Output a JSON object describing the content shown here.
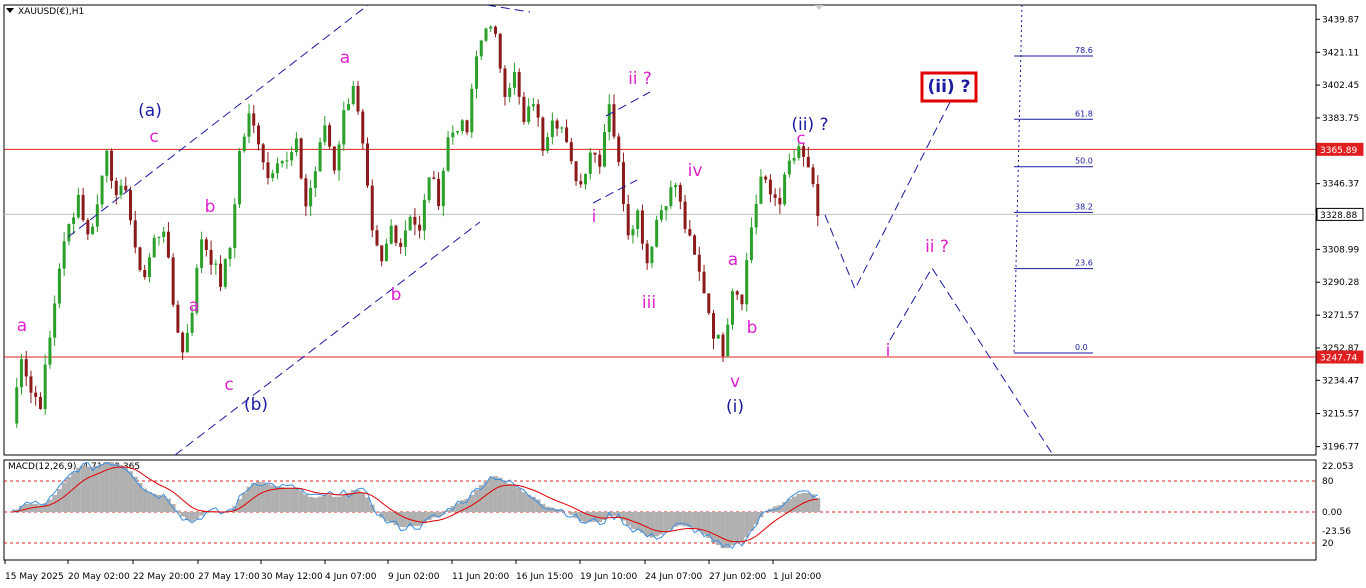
{
  "symbol_title": "XAUUSD(€),H1",
  "macd_title": "MACD(12,26,9) -4.711 -2.365",
  "colors": {
    "bull": "#2aa02a",
    "bear": "#8b1a1a",
    "wave_blue": "#1a1aa0",
    "wave_magenta": "#e020d0",
    "hline": "#e02020",
    "fib": "#1a1aa0",
    "signal": "#e00000",
    "macd_line": "#3a8ee0",
    "hist": "#b0b0b0"
  },
  "price_axis": {
    "labels": [
      "3439.87",
      "3421.11",
      "3402.45",
      "3383.75",
      "3365.04",
      "3346.37",
      "3327.69",
      "3308.99",
      "3290.28",
      "3271.57",
      "3252.87",
      "3234.47",
      "3215.57",
      "3196.77"
    ]
  },
  "price_tags": [
    {
      "label": "3365.89",
      "style": "red"
    },
    {
      "label": "3328.88",
      "style": "current"
    },
    {
      "label": "3247.74",
      "style": "red"
    }
  ],
  "time_axis": {
    "labels": [
      "15 May 2025",
      "20 May 02:00",
      "22 May 20:00",
      "27 May 17:00",
      "30 May 12:00",
      "4 Jun 07:00",
      "9 Jun 02:00",
      "11 Jun 20:00",
      "16 Jun 15:00",
      "19 Jun 10:00",
      "24 Jun 07:00",
      "27 Jun 02:00",
      "1 Jul 20:00"
    ]
  },
  "fib_levels": [
    {
      "label": "78.6",
      "price": 3419
    },
    {
      "label": "61.8",
      "price": 3383
    },
    {
      "label": "50.0",
      "price": 3356
    },
    {
      "label": "38.2",
      "price": 3330
    },
    {
      "label": "23.6",
      "price": 3298
    },
    {
      "label": "0.0",
      "price": 3250
    }
  ],
  "horizontal_lines": [
    3365.89,
    3247.74
  ],
  "current_price": 3328.88,
  "wave_labels": [
    {
      "text": "a",
      "color": "magenta"
    },
    {
      "text": "(a)",
      "color": "blue"
    },
    {
      "text": "c",
      "color": "magenta"
    },
    {
      "text": "b",
      "color": "magenta"
    },
    {
      "text": "a",
      "color": "magenta"
    },
    {
      "text": "c",
      "color": "magenta"
    },
    {
      "text": "(b)",
      "color": "blue"
    },
    {
      "text": "a",
      "color": "magenta"
    },
    {
      "text": "b",
      "color": "magenta"
    },
    {
      "text": "ii ?",
      "color": "magenta"
    },
    {
      "text": "i",
      "color": "magenta"
    },
    {
      "text": "iii",
      "color": "magenta"
    },
    {
      "text": "iv",
      "color": "magenta"
    },
    {
      "text": "a",
      "color": "magenta"
    },
    {
      "text": "b",
      "color": "magenta"
    },
    {
      "text": "v",
      "color": "magenta"
    },
    {
      "text": "(i)",
      "color": "blue"
    },
    {
      "text": "(ii) ?",
      "color": "blue"
    },
    {
      "text": "c",
      "color": "magenta"
    },
    {
      "text": "ii ?",
      "color": "magenta"
    },
    {
      "text": "i",
      "color": "magenta"
    },
    {
      "text": "(ii) ?",
      "color": "blue_boxed"
    }
  ],
  "macd_axis": {
    "labels": [
      "22.053",
      "80",
      "0.00",
      "-23.56",
      "20"
    ]
  },
  "chart_data": {
    "type": "line",
    "title": "XAUUSD(€),H1",
    "ylim": [
      3192,
      3448
    ],
    "x": [
      "15 May 2025",
      "20 May 02:00",
      "22 May 20:00",
      "27 May 17:00",
      "30 May 12:00",
      "4 Jun 07:00",
      "9 Jun 02:00",
      "11 Jun 20:00",
      "16 Jun 15:00",
      "19 Jun 10:00",
      "24 Jun 07:00",
      "27 Jun 02:00",
      "1 Jul 20:00"
    ],
    "series": [
      {
        "name": "XAUUSD(€),H1",
        "anchor_points": [
          [
            0,
            3210
          ],
          [
            2,
            3250
          ],
          [
            4,
            3228
          ],
          [
            6,
            3222
          ],
          [
            8,
            3258
          ],
          [
            10,
            3300
          ],
          [
            12,
            3322
          ],
          [
            14,
            3340
          ],
          [
            16,
            3316
          ],
          [
            18,
            3334
          ],
          [
            20,
            3368
          ],
          [
            22,
            3336
          ],
          [
            24,
            3346
          ],
          [
            26,
            3306
          ],
          [
            28,
            3294
          ],
          [
            30,
            3314
          ],
          [
            32,
            3322
          ],
          [
            34,
            3278
          ],
          [
            36,
            3250
          ],
          [
            38,
            3276
          ],
          [
            40,
            3316
          ],
          [
            42,
            3304
          ],
          [
            44,
            3290
          ],
          [
            46,
            3310
          ],
          [
            48,
            3364
          ],
          [
            50,
            3384
          ],
          [
            52,
            3372
          ],
          [
            54,
            3350
          ],
          [
            56,
            3362
          ],
          [
            58,
            3358
          ],
          [
            60,
            3368
          ],
          [
            62,
            3334
          ],
          [
            64,
            3354
          ],
          [
            66,
            3380
          ],
          [
            68,
            3356
          ],
          [
            70,
            3386
          ],
          [
            72,
            3404
          ],
          [
            74,
            3366
          ],
          [
            76,
            3316
          ],
          [
            78,
            3300
          ],
          [
            80,
            3322
          ],
          [
            82,
            3312
          ],
          [
            84,
            3330
          ],
          [
            86,
            3318
          ],
          [
            88,
            3352
          ],
          [
            90,
            3338
          ],
          [
            92,
            3372
          ],
          [
            94,
            3380
          ],
          [
            96,
            3376
          ],
          [
            98,
            3418
          ],
          [
            100,
            3438
          ],
          [
            102,
            3428
          ],
          [
            104,
            3400
          ],
          [
            106,
            3408
          ],
          [
            108,
            3380
          ],
          [
            110,
            3394
          ],
          [
            112,
            3368
          ],
          [
            114,
            3386
          ],
          [
            116,
            3378
          ],
          [
            118,
            3356
          ],
          [
            120,
            3346
          ],
          [
            122,
            3366
          ],
          [
            124,
            3360
          ],
          [
            126,
            3394
          ],
          [
            128,
            3356
          ],
          [
            130,
            3320
          ],
          [
            132,
            3330
          ],
          [
            134,
            3302
          ],
          [
            136,
            3326
          ],
          [
            138,
            3338
          ],
          [
            140,
            3346
          ],
          [
            142,
            3322
          ],
          [
            144,
            3304
          ],
          [
            146,
            3286
          ],
          [
            148,
            3262
          ],
          [
            150,
            3252
          ],
          [
            152,
            3288
          ],
          [
            154,
            3282
          ],
          [
            156,
            3322
          ],
          [
            158,
            3350
          ],
          [
            160,
            3340
          ],
          [
            162,
            3338
          ],
          [
            164,
            3358
          ],
          [
            166,
            3364
          ],
          [
            168,
            3356
          ],
          [
            170,
            3328
          ]
        ]
      }
    ]
  }
}
